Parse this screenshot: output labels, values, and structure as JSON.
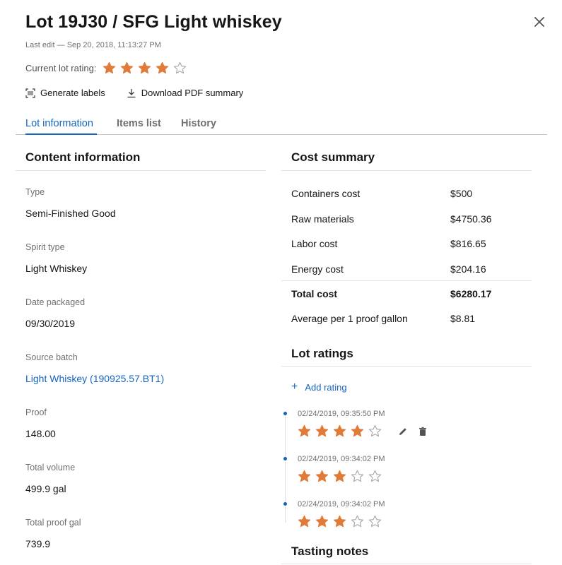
{
  "header": {
    "title": "Lot 19J30 / SFG Light whiskey",
    "last_edit": "Last edit — Sep 20, 2018, 11:13:27 PM",
    "rating_label": "Current lot rating:",
    "rating_value": 4,
    "rating_max": 5
  },
  "actions": {
    "generate_labels": "Generate labels",
    "download_pdf": "Download PDF summary"
  },
  "tabs": [
    {
      "label": "Lot information",
      "active": true
    },
    {
      "label": "Items list",
      "active": false
    },
    {
      "label": "History",
      "active": false
    }
  ],
  "content_info": {
    "heading": "Content information",
    "fields": [
      {
        "label": "Type",
        "value": "Semi-Finished Good"
      },
      {
        "label": "Spirit type",
        "value": "Light Whiskey"
      },
      {
        "label": "Date packaged",
        "value": "09/30/2019"
      },
      {
        "label": "Source batch",
        "value": "Light Whiskey (190925.57.BT1)"
      },
      {
        "label": "Proof",
        "value": "148.00"
      },
      {
        "label": "Total volume",
        "value": "499.9 gal"
      },
      {
        "label": "Total proof gal",
        "value": "739.9"
      }
    ]
  },
  "cost_summary": {
    "heading": "Cost summary",
    "rows": [
      {
        "label": "Containers cost",
        "value": "$500"
      },
      {
        "label": "Raw materials",
        "value": "$4750.36"
      },
      {
        "label": "Labor cost",
        "value": "$816.65"
      },
      {
        "label": "Energy cost",
        "value": "$204.16"
      },
      {
        "label": "Total cost",
        "value": "$6280.17"
      },
      {
        "label": "Average per 1 proof gallon",
        "value": "$8.81"
      }
    ]
  },
  "lot_ratings": {
    "heading": "Lot ratings",
    "add_label": "Add rating",
    "entries": [
      {
        "time": "02/24/2019, 09:35:50 PM",
        "rating": 4
      },
      {
        "time": "02/24/2019, 09:34:02 PM",
        "rating": 3
      },
      {
        "time": "02/24/2019, 09:34:02 PM",
        "rating": 3
      }
    ]
  },
  "tasting_notes": {
    "heading": "Tasting notes"
  },
  "colors": {
    "accent": "#1565c0",
    "star_filled": "#e07b39",
    "star_empty": "#a8a8a8"
  },
  "icons": {
    "close": "close-icon",
    "generate_labels": "barcode-icon",
    "download": "download-icon",
    "edit": "pencil-icon",
    "delete": "trash-icon",
    "add": "plus-icon"
  }
}
